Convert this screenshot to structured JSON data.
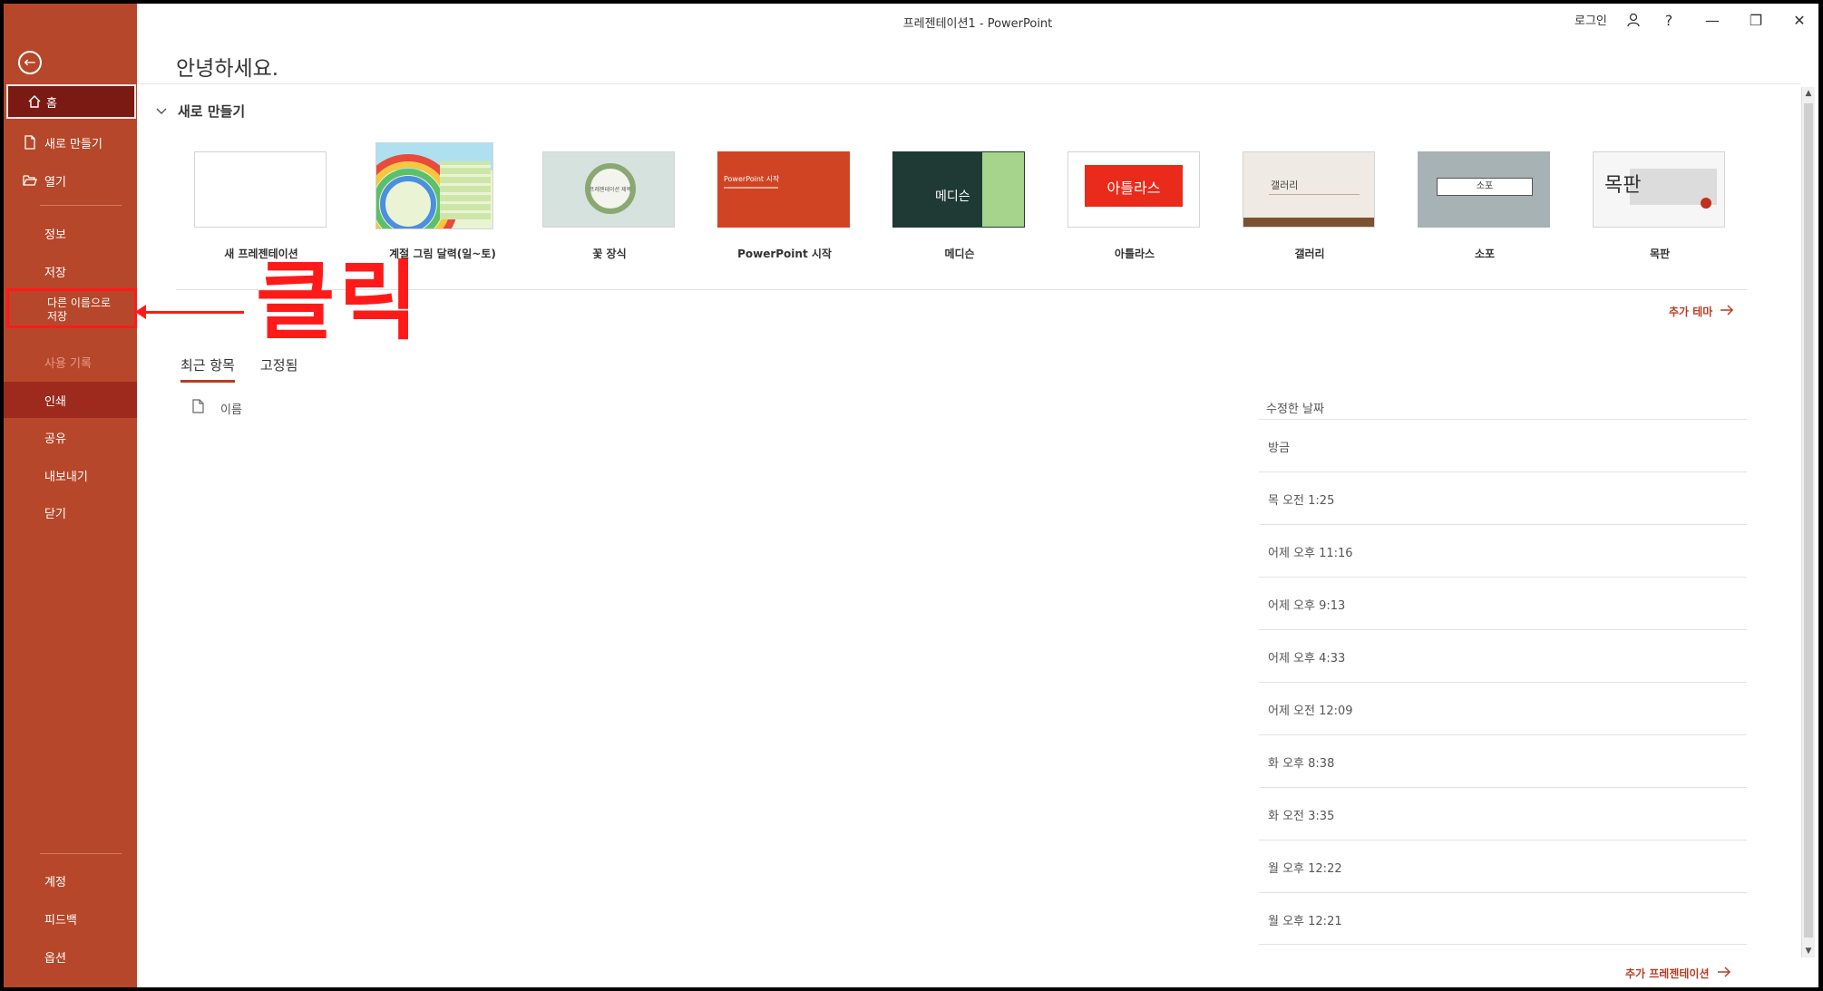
{
  "window": {
    "title": "프레젠테이션1  -  PowerPoint",
    "signin": "로그인",
    "help_label": "?",
    "minimize_label": "—",
    "restore_label": "❐",
    "close_label": "✕"
  },
  "sidebar": {
    "back_icon": "←",
    "home": "홈",
    "new": "새로 만들기",
    "open": "열기",
    "info": "정보",
    "save": "저장",
    "save_as_line1": "다른 이름으로",
    "save_as_line2": "저장",
    "history": "사용 기록",
    "print": "인쇄",
    "share": "공유",
    "export": "내보내기",
    "close": "닫기",
    "account": "계정",
    "feedback": "피드백",
    "options": "옵션"
  },
  "greeting": "안녕하세요.",
  "new_section": {
    "title": "새로 만들기",
    "templates": [
      {
        "name": "새 프레젠테이션"
      },
      {
        "name": "계절 그림 달력(일~토)"
      },
      {
        "name": "꽃 장식",
        "thumb_text": "프레젠테이션 제목"
      },
      {
        "name": "PowerPoint 시작",
        "thumb_text": "PowerPoint 시작"
      },
      {
        "name": "메디슨",
        "thumb_text": "메디슨"
      },
      {
        "name": "아틀라스",
        "thumb_text": "아틀라스"
      },
      {
        "name": "갤러리",
        "thumb_text": "갤러리"
      },
      {
        "name": "소포",
        "thumb_text": "소포"
      },
      {
        "name": "목판",
        "thumb_text": "목판"
      }
    ],
    "more_themes": "추가 테마"
  },
  "annotation": {
    "click_text": "클릭"
  },
  "recent": {
    "tabs": [
      "최근 항목",
      "고정됨"
    ],
    "col_name": "이름",
    "col_date": "수정한 날짜",
    "dates": [
      "방금",
      "목 오전 1:25",
      "어제 오후 11:16",
      "어제 오후 9:13",
      "어제 오후 4:33",
      "어제 오전 12:09",
      "화 오후 8:38",
      "화 오전 3:35",
      "월 오후 12:22",
      "월 오후 12:21"
    ],
    "more_presentations": "추가 프레젠테이션"
  },
  "colors": {
    "sidebar": "#b7472a",
    "accent": "#b83c22",
    "annotation": "#ff1a1a"
  }
}
